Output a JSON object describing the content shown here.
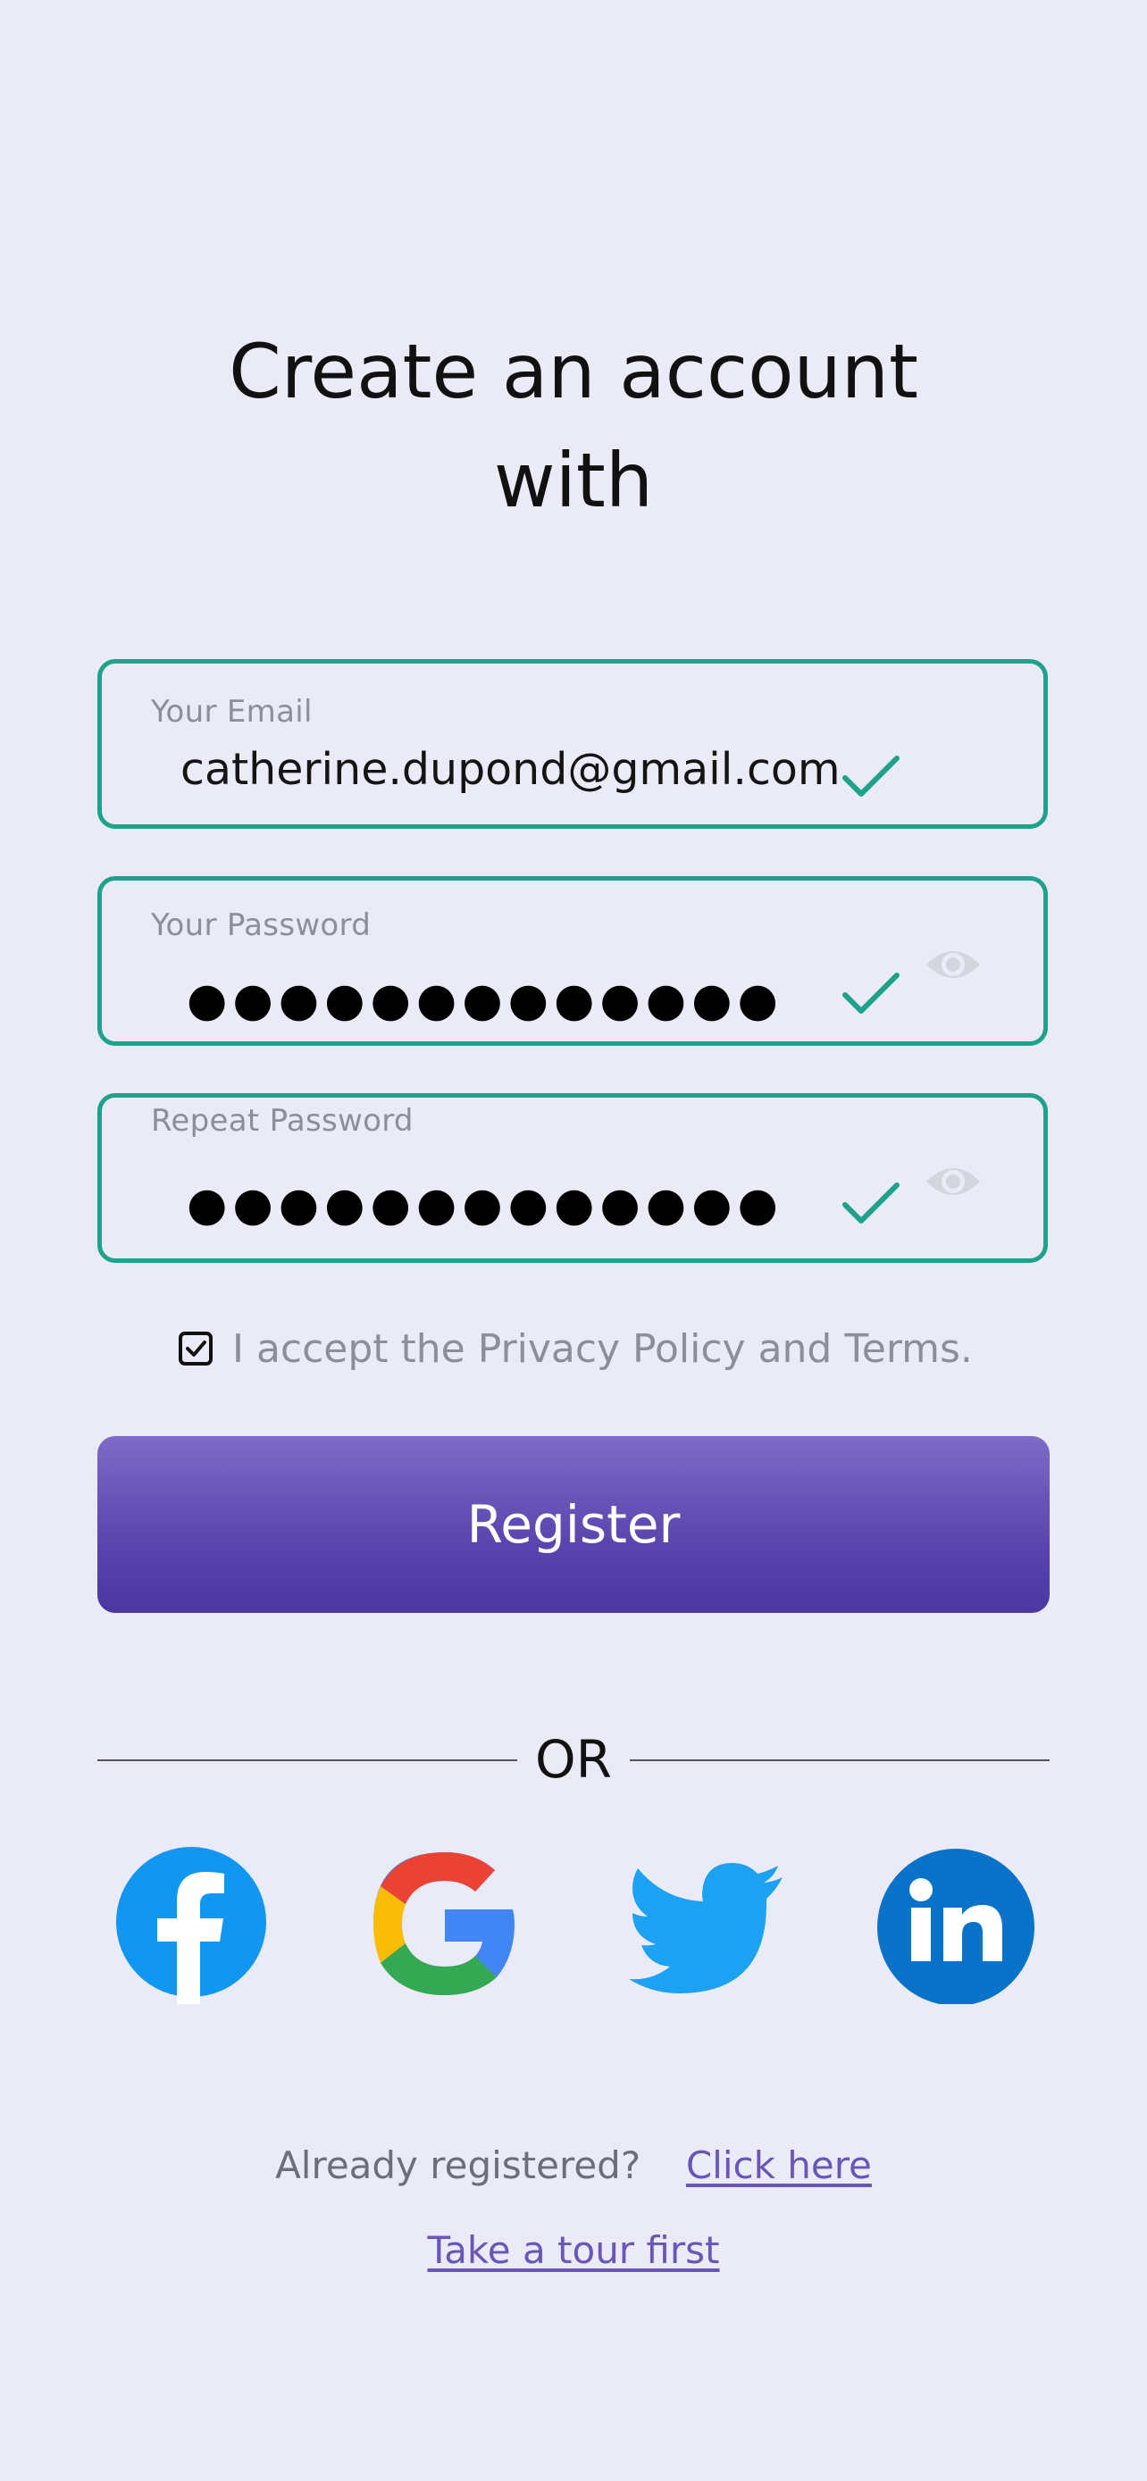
{
  "header": {
    "title_line1": "Create an account",
    "title_line2": "with"
  },
  "form": {
    "email": {
      "label": "Your Email",
      "value": "catherine.dupond@gmail.com",
      "valid": true
    },
    "password": {
      "label": "Your Password",
      "masked_value": "●●●●●●●●●●●●●",
      "valid": true
    },
    "repeat_password": {
      "label": "Repeat Password",
      "masked_value": "●●●●●●●●●●●●●",
      "valid": true
    },
    "accept_terms": {
      "label": "I accept the Privacy Policy and Terms.",
      "checked": true
    },
    "register_label": "Register"
  },
  "divider": {
    "label": "OR"
  },
  "social": [
    {
      "name": "facebook-icon",
      "color": "#1196F2"
    },
    {
      "name": "google-icon",
      "color": "#4285F4"
    },
    {
      "name": "twitter-icon",
      "color": "#1DA1F2"
    },
    {
      "name": "linkedin-icon",
      "color": "#0A72C8"
    }
  ],
  "footer": {
    "already_text": "Already registered?",
    "click_here": "Click here",
    "tour_link": "Take a tour first"
  },
  "colors": {
    "background": "#EBEBF8",
    "accent_green": "#1FA28A",
    "button_purple": "#5A45AE",
    "link_purple": "#6A55B8"
  }
}
